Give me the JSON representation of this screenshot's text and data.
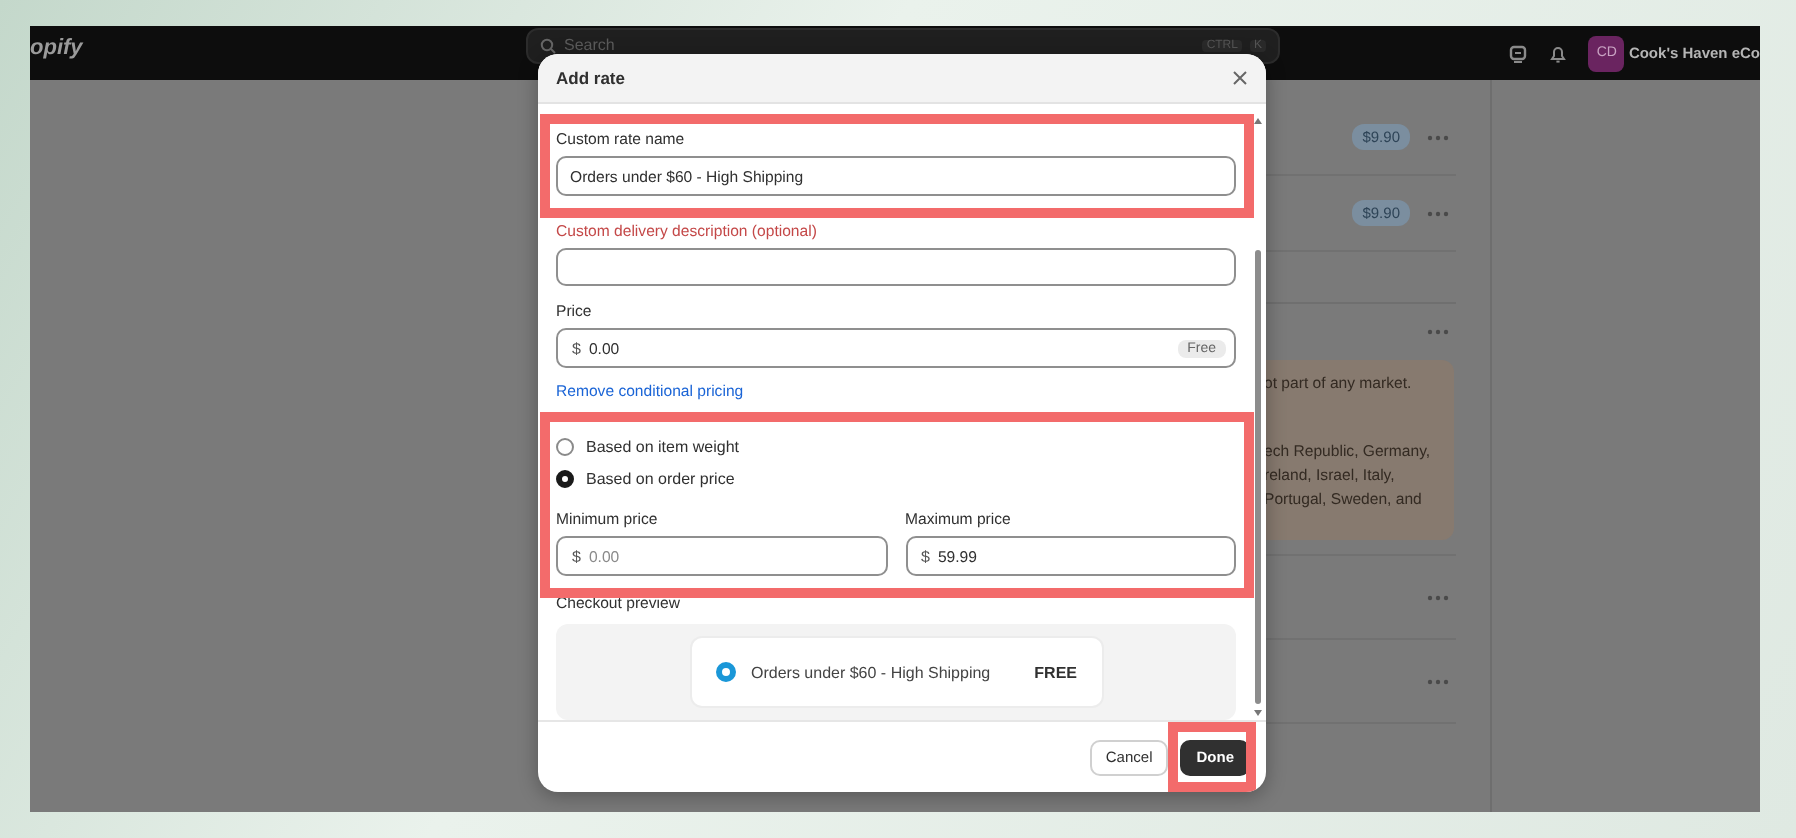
{
  "topbar": {
    "brand": "opify",
    "search": {
      "placeholder": "Search",
      "keys": [
        "CTRL",
        "K"
      ]
    },
    "user": {
      "initials": "CD",
      "store": "Cook's Haven eCo"
    }
  },
  "background": {
    "rows": [
      {
        "kind": "rate",
        "price": "$9.90"
      },
      {
        "kind": "rate",
        "price": "$9.90"
      },
      {
        "kind": "gap"
      },
      {
        "kind": "header"
      },
      {
        "kind": "notice",
        "lines": [
          "ot part of any market.",
          "ech Republic, Germany,",
          "reland, Israel, Italy,",
          "Portugal, Sweden, and"
        ]
      },
      {
        "kind": "plain"
      },
      {
        "kind": "plain"
      }
    ]
  },
  "modal": {
    "title": "Add rate",
    "name_field": {
      "label": "Custom rate name",
      "value": "Orders under $60 - High Shipping",
      "highlighted": true
    },
    "description_field": {
      "label": "Custom delivery description (optional)"
    },
    "price_field": {
      "label": "Price",
      "prefix": "$",
      "value": "0.00",
      "badge": "Free"
    },
    "link": "Remove conditional pricing",
    "conditions": {
      "highlighted": true,
      "options": [
        {
          "label": "Based on item weight",
          "selected": false
        },
        {
          "label": "Based on order price",
          "selected": true
        }
      ],
      "min": {
        "label": "Minimum price",
        "prefix": "$",
        "placeholder": "0.00"
      },
      "max": {
        "label": "Maximum price",
        "prefix": "$",
        "value": "59.99"
      }
    },
    "preview": {
      "label": "Checkout preview",
      "option": "Orders under $60 - High Shipping",
      "price": "FREE",
      "selected": true
    },
    "buttons": [
      {
        "kind": "secondary",
        "label": "Cancel",
        "highlighted": false
      },
      {
        "kind": "primary",
        "label": "Done",
        "highlighted": true
      }
    ]
  }
}
